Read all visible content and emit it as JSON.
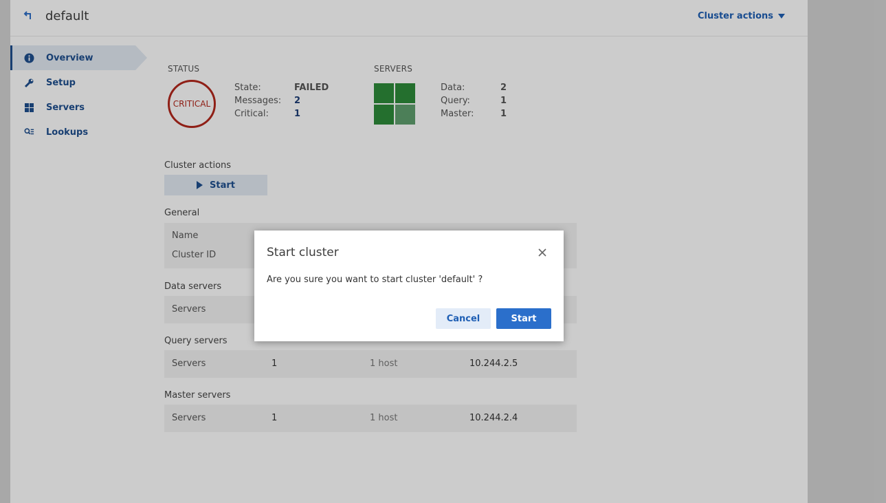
{
  "header": {
    "title": "default",
    "cluster_actions": "Cluster actions"
  },
  "sidebar": {
    "items": [
      {
        "label": "Overview",
        "icon": "info-icon",
        "active": true
      },
      {
        "label": "Setup",
        "icon": "wrench-icon"
      },
      {
        "label": "Servers",
        "icon": "grid-icon"
      },
      {
        "label": "Lookups",
        "icon": "search-list-icon"
      }
    ]
  },
  "status": {
    "caption": "STATUS",
    "badge": "CRITICAL",
    "state_label": "State:",
    "state_value": "FAILED",
    "messages_label": "Messages:",
    "messages_value": "2",
    "critical_label": "Critical:",
    "critical_value": "1"
  },
  "servers_summary": {
    "caption": "SERVERS",
    "data_label": "Data:",
    "data_value": "2",
    "query_label": "Query:",
    "query_value": "1",
    "master_label": "Master:",
    "master_value": "1"
  },
  "cluster_actions": {
    "heading": "Cluster actions",
    "start_label": "Start"
  },
  "general": {
    "heading": "General",
    "name_label": "Name",
    "cluster_id_label": "Cluster ID"
  },
  "data_servers": {
    "heading": "Data servers",
    "servers_label": "Servers"
  },
  "query_servers": {
    "heading": "Query servers",
    "servers_label": "Servers",
    "count": "1",
    "hosts": "1 host",
    "ip": "10.244.2.5"
  },
  "master_servers": {
    "heading": "Master servers",
    "servers_label": "Servers",
    "count": "1",
    "hosts": "1 host",
    "ip": "10.244.2.4"
  },
  "modal": {
    "title": "Start cluster",
    "message": "Are you sure you want to start cluster 'default' ?",
    "cancel_label": "Cancel",
    "confirm_label": "Start"
  },
  "colors": {
    "accent": "#2b6fcb",
    "critical": "#b3271c",
    "server_ok": "#2e8b3a"
  }
}
